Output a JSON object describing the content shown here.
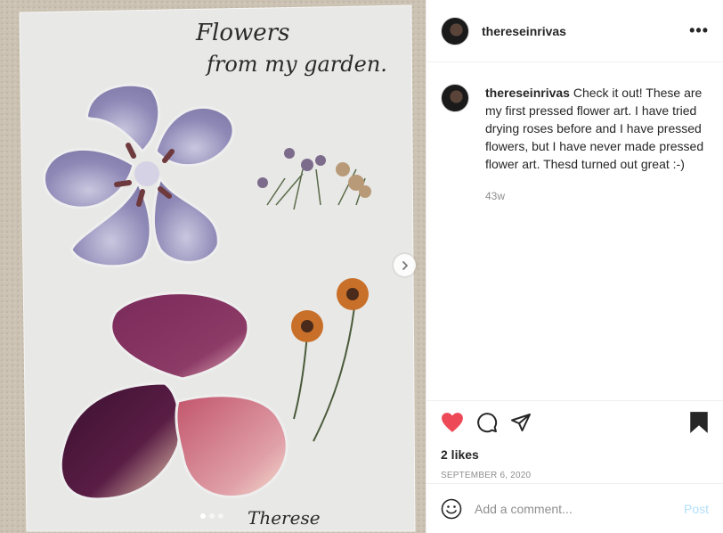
{
  "post": {
    "username": "thereseinrivas",
    "caption_text": "Check it out! These are my first pressed flower art. I have tried drying roses before and I have pressed flowers, but I have never made pressed flower art. Thesd turned out great :-)",
    "time_ago": "43w",
    "likes": "2 likes",
    "date": "SEPTEMBER 6, 2020"
  },
  "image": {
    "handwritten_title_line1": "Flowers",
    "handwritten_title_line2": "from my garden.",
    "signature": "Therese"
  },
  "carousel": {
    "total": 3,
    "current": 1
  },
  "comment_box": {
    "placeholder": "Add a comment...",
    "post_label": "Post"
  },
  "icons": {
    "more": "more-options-icon",
    "like": "heart-filled-icon",
    "comment": "comment-icon",
    "share": "share-icon",
    "save": "bookmark-filled-icon",
    "emoji": "emoji-icon",
    "next": "chevron-right-icon"
  },
  "colors": {
    "like": "#ed4956",
    "post_disabled": "#b2dffc",
    "meta": "#8e8e8e"
  }
}
